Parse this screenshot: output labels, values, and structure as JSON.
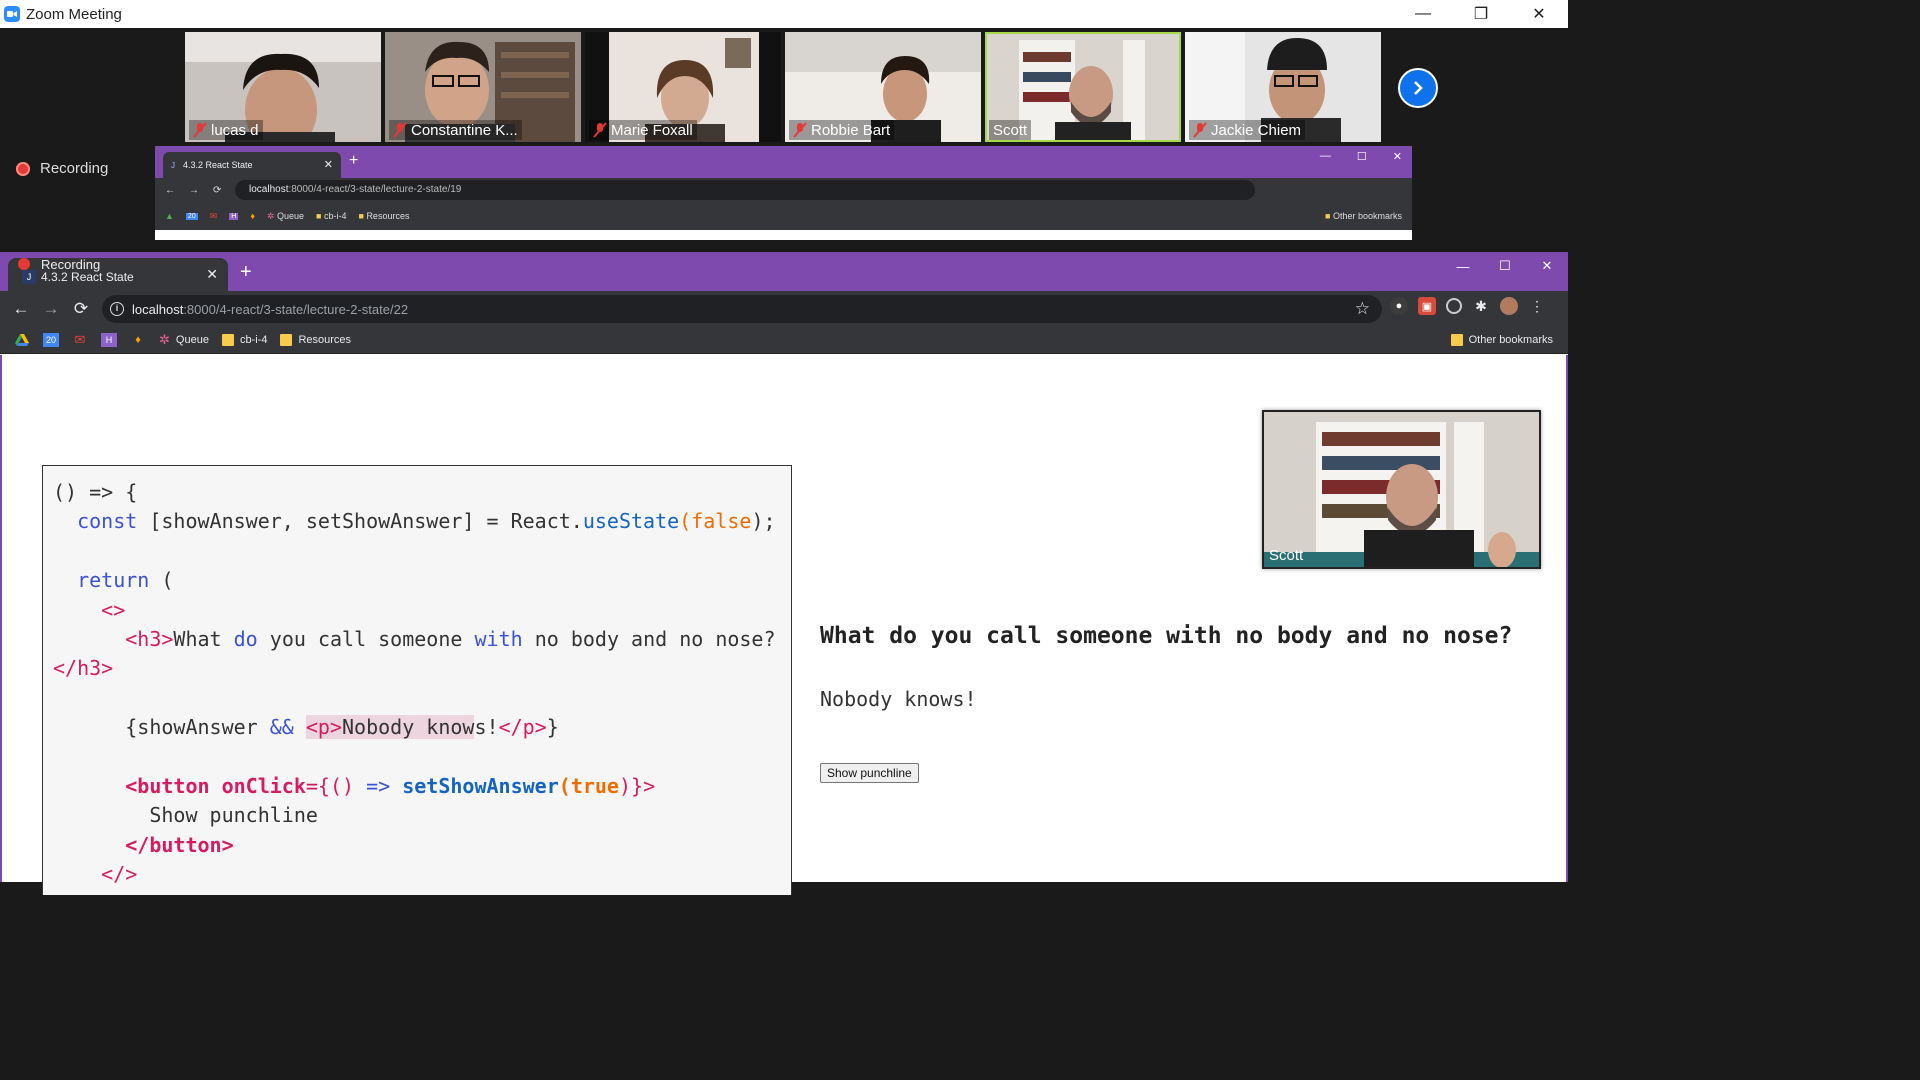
{
  "zoom": {
    "title": "Zoom Meeting",
    "recording_label": "Recording",
    "participants": [
      {
        "name": "lucas d"
      },
      {
        "name": "Constantine K..."
      },
      {
        "name": "Marie Foxall"
      },
      {
        "name": "Robbie Bart"
      },
      {
        "name": "Scott"
      },
      {
        "name": "Jackie Chiem"
      }
    ],
    "active_speaker": "Scott",
    "self_view_name": "Scott"
  },
  "mini_browser": {
    "tab_title": "4.3.2 React State",
    "url_host": "localhost",
    "url_path": ":8000/4-react/3-state/lecture-2-state/19",
    "bookmarks": [
      "Queue",
      "cb-i-4",
      "Resources"
    ],
    "other_bookmarks": "Other bookmarks"
  },
  "browser": {
    "recording_label": "Recording",
    "tab_title": "4.3.2 React State",
    "url_host": "localhost",
    "url_path": ":8000/4-react/3-state/lecture-2-state/22",
    "bookmarks": {
      "queue": "Queue",
      "cb": "cb-i-4",
      "resources": "Resources",
      "other": "Other bookmarks"
    },
    "accent_color": "#7f4aad"
  },
  "code": {
    "l1": "() => {",
    "const_kw": "const",
    "destructure": " [showAnswer, setShowAnswer] = React.",
    "use_state": "useState",
    "paren_open": "(",
    "false_lit": "false",
    "paren_close": ");",
    "return_kw": "return",
    "return_paren": " (",
    "fragment_open": "<>",
    "h3_open": "<h3>",
    "h3_text_a": "What ",
    "h3_do": "do",
    "h3_text_b": " you call someone ",
    "h3_with": "with",
    "h3_text_c": " no body and no nose?",
    "h3_close": "</h3>",
    "cond_a": "{showAnswer ",
    "cond_and": "&&",
    "p_open": "<p>",
    "p_text_hl": "Nobody know",
    "p_text_rest": "s!",
    "p_close": "</p>",
    "cond_end": "}",
    "button_open": "<button",
    "onclick": " onClick",
    "eq_brace": "={",
    "arrow_a": "() ",
    "arrow": "=>",
    "set_fn": " setShowAnswer",
    "true_lit": "true",
    "button_open_end": ")}>",
    "button_text": "Show punchline",
    "button_close": "</button>",
    "fragment_close": "</>"
  },
  "output": {
    "h3": "What do you call someone with no body and no nose?",
    "p": "Nobody knows!",
    "button": "Show punchline"
  }
}
